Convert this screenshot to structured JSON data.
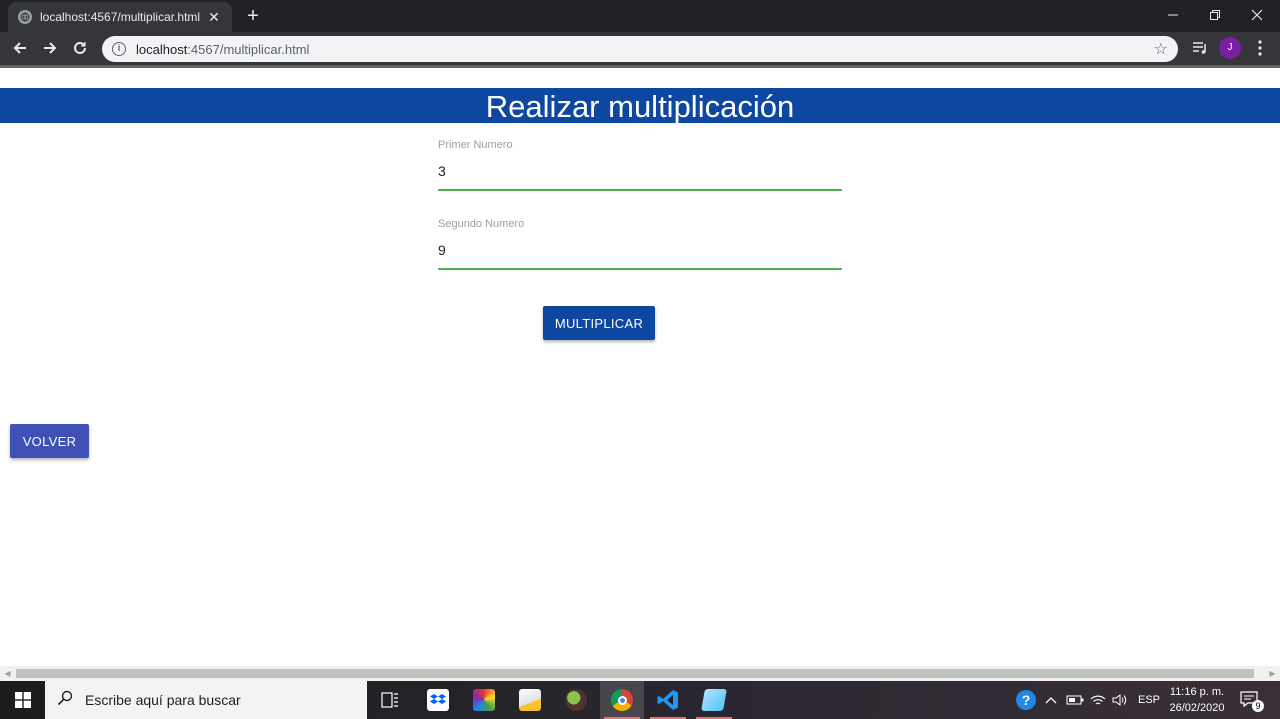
{
  "browser": {
    "tab_title": "localhost:4567/multiplicar.html",
    "tab_close": "✕",
    "new_tab": "+",
    "url_host": "localhost",
    "url_path": ":4567/multiplicar.html",
    "avatar_letter": "J"
  },
  "page": {
    "title": "Realizar multiplicación",
    "fields": [
      {
        "label": "Primer Numero",
        "value": "3"
      },
      {
        "label": "Segundo Numero",
        "value": "9"
      }
    ],
    "multiply_button": "MULTIPLICAR",
    "back_button": "VOLVER"
  },
  "taskbar": {
    "search_placeholder": "Escribe aquí para buscar",
    "language": "ESP",
    "time": "11:16 p. m.",
    "date": "26/02/2020",
    "notification_count": "9"
  },
  "colors": {
    "header_bg": "#0d47a1",
    "field_underline": "#4caf50",
    "multiply_button_bg": "#0d47a1",
    "back_button_bg": "#3f51b5"
  }
}
